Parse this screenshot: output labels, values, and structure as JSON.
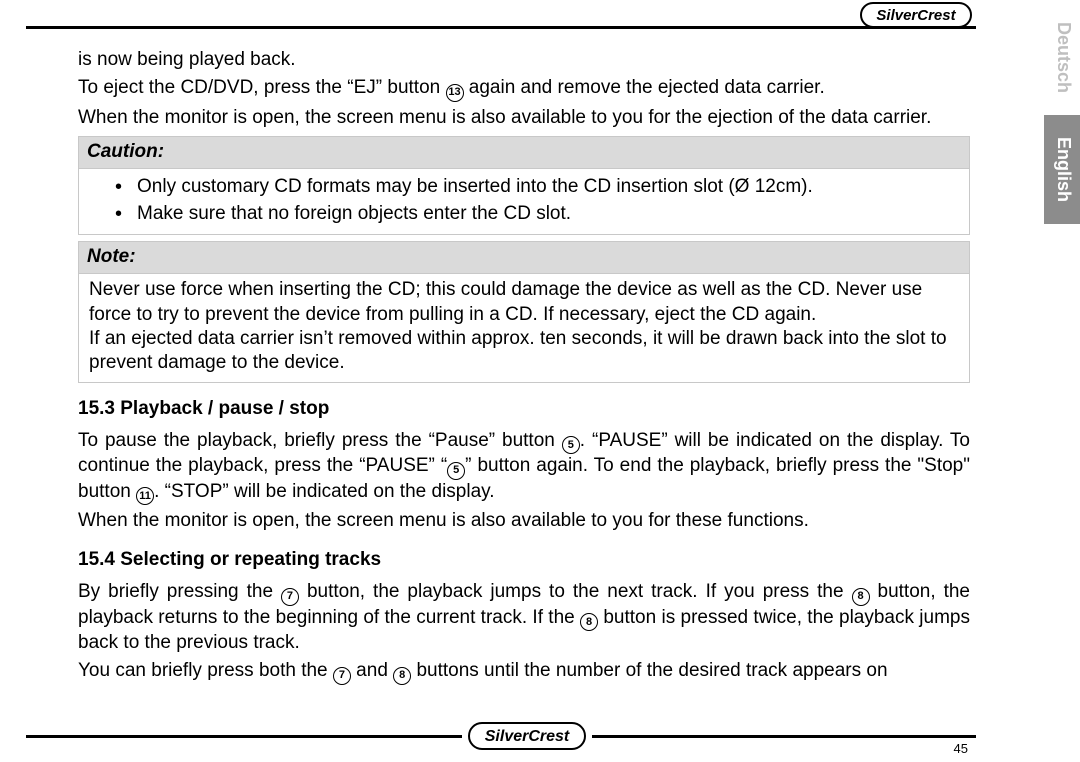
{
  "brand": "SilverCrest",
  "page_number": "45",
  "languages": {
    "de": "Deutsch",
    "en": "English"
  },
  "intro": {
    "line1": "is now being played back.",
    "line2_a": "To eject the CD/DVD, press the “EJ” button ",
    "line2_ref": "13",
    "line2_b": " again and remove the ejected data carrier.",
    "line3": "When the monitor is open, the screen menu is also available to you for the ejection of the data carrier."
  },
  "caution": {
    "title": "Caution:",
    "items": [
      "Only customary CD formats may be inserted into the CD insertion slot (Ø 12cm).",
      "Make sure that no foreign objects enter the CD slot."
    ]
  },
  "note": {
    "title": "Note:",
    "p1": "Never use force when inserting the CD; this could damage the device as well as the CD. Never use force to try to prevent the device from pulling in a CD. If necessary, eject the CD again.",
    "p2": "If an ejected data carrier isn’t removed within approx. ten seconds, it will be drawn back into the slot to prevent damage to the device."
  },
  "s153": {
    "heading": "15.3 Playback / pause / stop",
    "t1": "To pause the playback, briefly press the “Pause” button ",
    "r1": "5",
    "t2": ". “PAUSE” will be indicated on the display. To continue the playback, press the “PAUSE” “",
    "r2": "5",
    "t3": "” button again. To end the playback, briefly press the \"Stop\" button ",
    "r3": "11",
    "t4": ". “STOP” will be indicated on the display.",
    "t5": "When the monitor is open, the screen menu is also available to you for these functions."
  },
  "s154": {
    "heading": "15.4 Selecting or repeating tracks",
    "t1": "By briefly pressing the ",
    "r1": "7",
    "t2": " button, the playback jumps to the next track. If you press the ",
    "r2": "8",
    "t3": " button, the playback returns to the beginning of the current track. If the ",
    "r3": "8",
    "t4": " button is pressed twice, the playback jumps back to the previous track.",
    "t5a": "You can briefly press both the ",
    "r4": "7",
    "t5b": " and ",
    "r5": "8",
    "t5c": " buttons until the number of the desired track appears on"
  }
}
